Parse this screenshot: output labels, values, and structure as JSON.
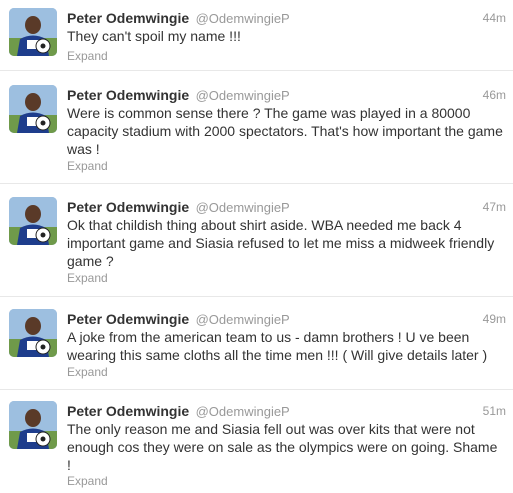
{
  "tweets": [
    {
      "fullname": "Peter Odemwingie",
      "username": "@OdemwingieP",
      "time": "44m",
      "text": "They can't spoil my name !!!",
      "expand": "Expand"
    },
    {
      "fullname": "Peter Odemwingie",
      "username": "@OdemwingieP",
      "time": "46m",
      "text": "Were is common sense there ? The game was played in a 80000 capacity stadium with 2000 spectators. That's how important the game was !",
      "expand": "Expand"
    },
    {
      "fullname": "Peter Odemwingie",
      "username": "@OdemwingieP",
      "time": "47m",
      "text": "Ok that childish thing about shirt aside. WBA needed me back 4 important game and Siasia refused to let me miss a midweek friendly game ?",
      "expand": "Expand"
    },
    {
      "fullname": "Peter Odemwingie",
      "username": "@OdemwingieP",
      "time": "49m",
      "text": "A joke from the american team to us - damn brothers ! U ve been wearing this same cloths all the time men !!! ( Will give details later )",
      "expand": "Expand"
    },
    {
      "fullname": "Peter Odemwingie",
      "username": "@OdemwingieP",
      "time": "51m",
      "text": "The only reason me and Siasia fell out was over kits that were not enough cos they were on sale as the olympics were on going. Shame !",
      "expand": "Expand"
    }
  ]
}
